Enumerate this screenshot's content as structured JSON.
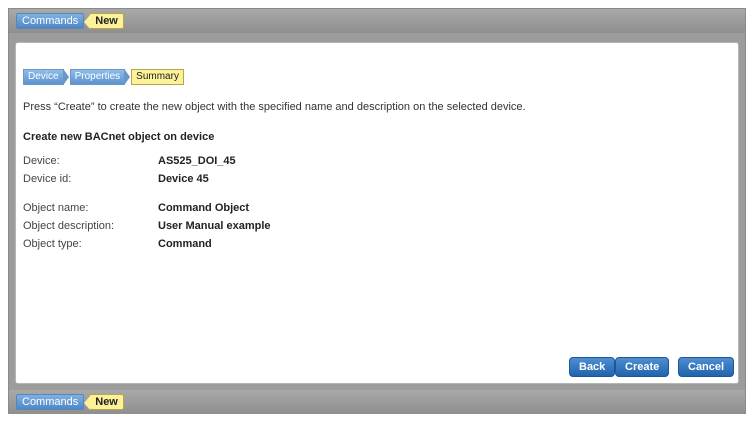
{
  "top_bar": {
    "commands_label": "Commands",
    "new_label": "New"
  },
  "bottom_bar": {
    "commands_label": "Commands",
    "new_label": "New"
  },
  "wizard": {
    "steps": [
      "Device",
      "Properties",
      "Summary"
    ],
    "active_step": "Summary",
    "instruction": "Press “Create” to create the new object with the specified name and description on the selected device.",
    "section_title": "Create new BACnet object on device",
    "fields": {
      "device": {
        "label": "Device:",
        "value": "AS525_DOI_45"
      },
      "device_id": {
        "label": "Device id:",
        "value": "Device 45"
      },
      "object_name": {
        "label": "Object name:",
        "value": "Command Object"
      },
      "object_description": {
        "label": "Object description:",
        "value": "User Manual example"
      },
      "object_type": {
        "label": "Object type:",
        "value": "Command"
      }
    }
  },
  "buttons": {
    "back": "Back",
    "create": "Create",
    "cancel": "Cancel"
  },
  "colors": {
    "accent_blue": "#2b6fb8",
    "active_yellow": "#fdf19a",
    "frame_gray": "#9c9c9c"
  }
}
